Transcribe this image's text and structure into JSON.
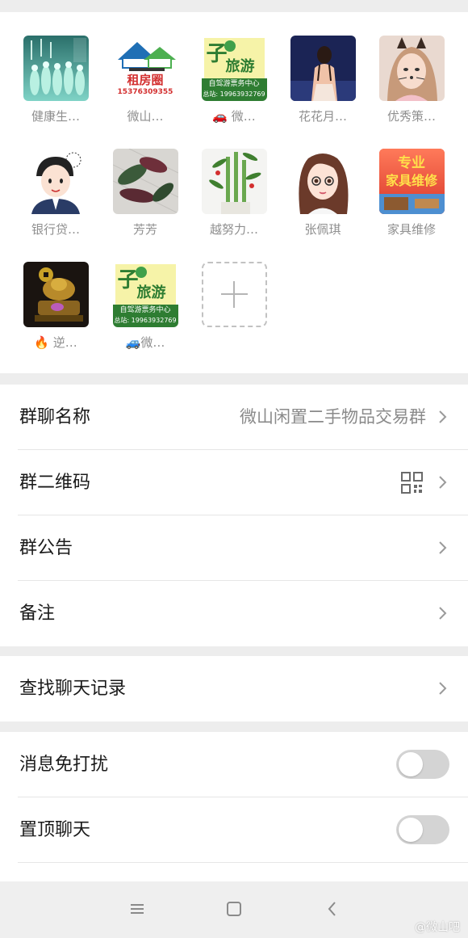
{
  "members": [
    {
      "name": "健康生…",
      "avatar_art": "dancers-photo"
    },
    {
      "name": "微山…",
      "avatar_art": "rental-logo",
      "lines": [
        "租房圈",
        "15376309355"
      ]
    },
    {
      "name": "🚗 微…",
      "avatar_art": "travel-logo",
      "lines": [
        "旅游",
        "自驾游票务中心",
        "总站: 19963932769"
      ]
    },
    {
      "name": "花花月…",
      "avatar_art": "woman-back-photo"
    },
    {
      "name": "优秀策…",
      "avatar_art": "cat-filter-selfie"
    },
    {
      "name": "银行贷…",
      "avatar_art": "cartoon-man"
    },
    {
      "name": "芳芳",
      "avatar_art": "plant-photo"
    },
    {
      "name": "越努力…",
      "avatar_art": "bamboo-photo"
    },
    {
      "name": "张佩琪",
      "avatar_art": "cartoon-girl"
    },
    {
      "name": "家具维修",
      "avatar_art": "furniture-repair",
      "lines": [
        "专业",
        "家具维修"
      ]
    },
    {
      "name": "🔥 逆…",
      "avatar_art": "golden-fountain"
    },
    {
      "name": "🚙微…",
      "avatar_art": "travel-logo",
      "lines": [
        "旅游",
        "自驾游票务中心",
        "总站: 19963932769"
      ]
    }
  ],
  "add_member_icon": "plus-icon",
  "settings": {
    "group_name": {
      "label": "群聊名称",
      "value": "微山闲置二手物品交易群"
    },
    "qr_code": {
      "label": "群二维码"
    },
    "announcement": {
      "label": "群公告"
    },
    "remark": {
      "label": "备注"
    },
    "search_history": {
      "label": "查找聊天记录"
    },
    "mute": {
      "label": "消息免打扰",
      "on": false
    },
    "pin": {
      "label": "置顶聊天",
      "on": false
    }
  },
  "nav": [
    "menu-icon",
    "home-icon",
    "back-icon"
  ],
  "watermark": "@微山吧",
  "colors": {
    "toggle_off": "#d4d4d4",
    "background": "#ededed"
  }
}
